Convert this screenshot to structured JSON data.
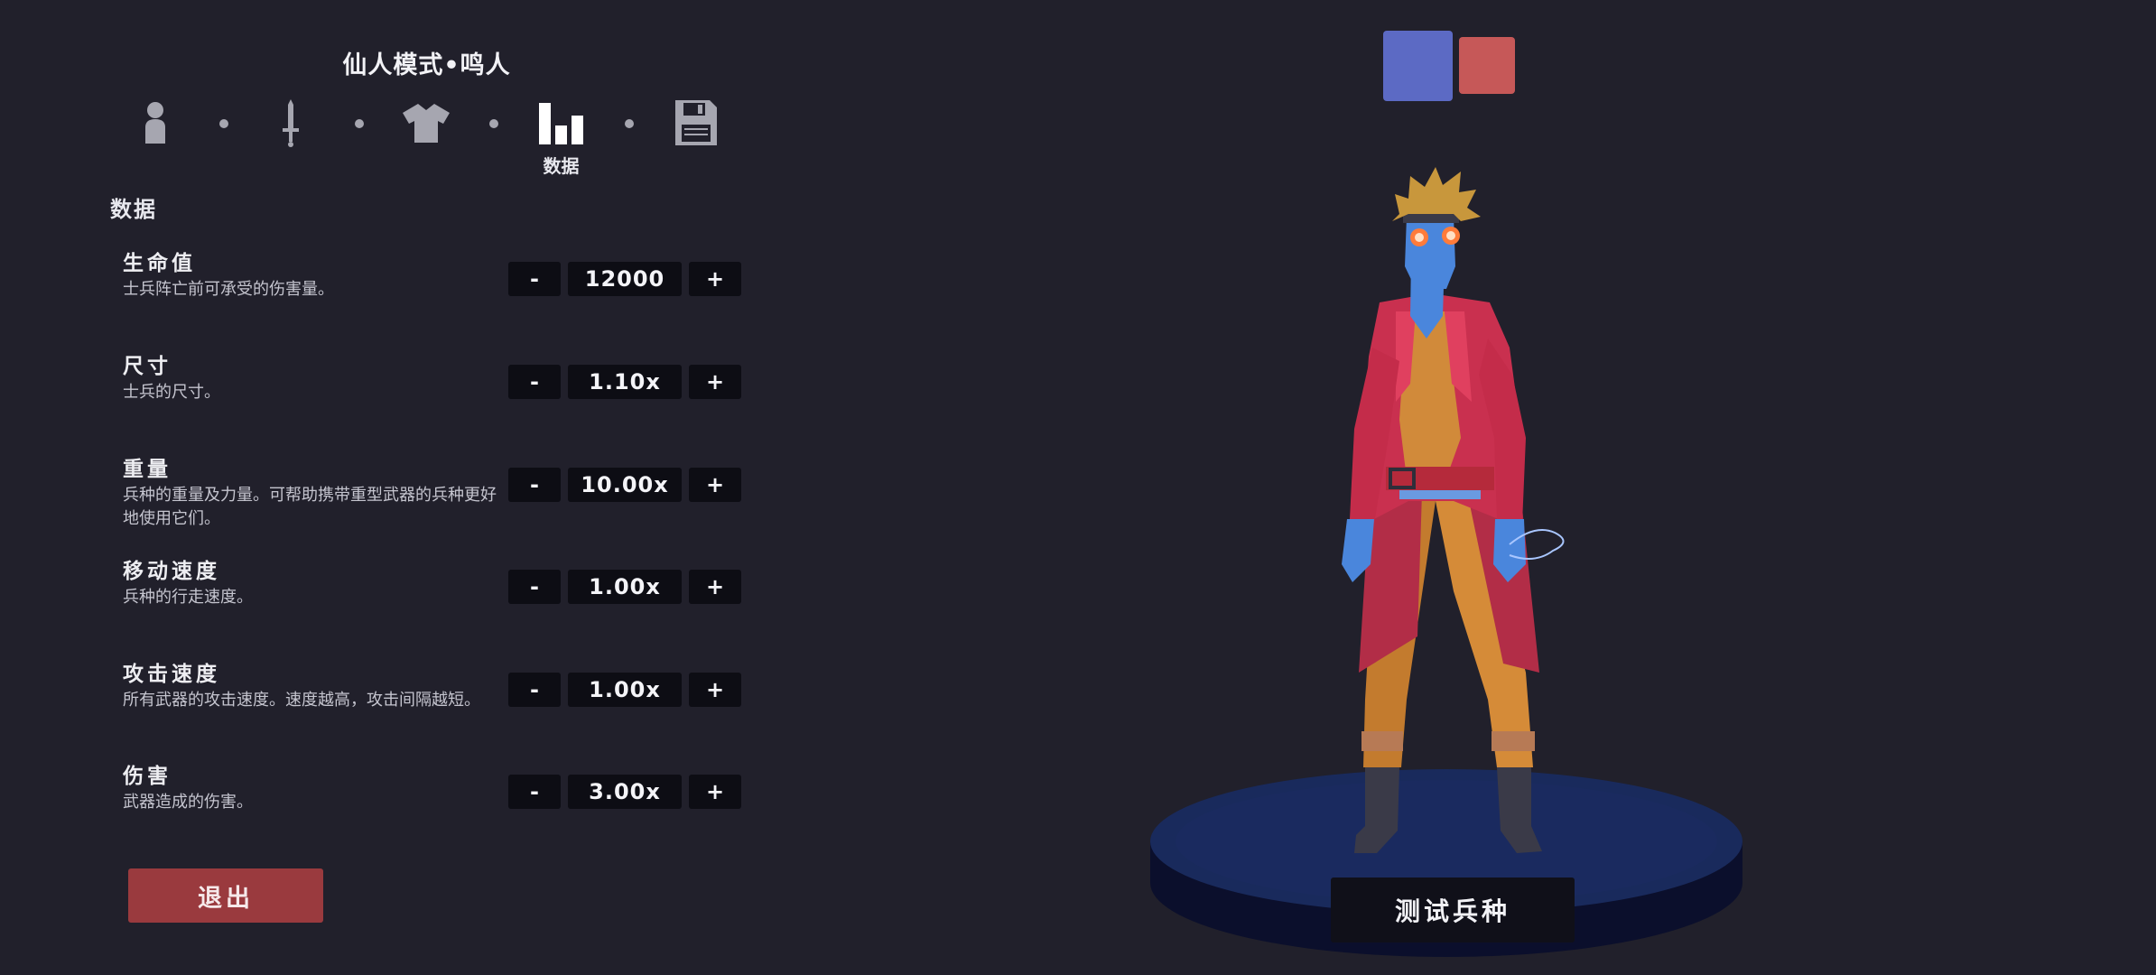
{
  "header": {
    "title": "仙人模式•鸣人",
    "steps": [
      {
        "icon": "person-icon",
        "active": false
      },
      {
        "icon": "sword-icon",
        "active": false
      },
      {
        "icon": "shirt-icon",
        "active": false
      },
      {
        "icon": "bar-chart-icon",
        "active": true,
        "caption": "数据"
      },
      {
        "icon": "floppy-disk-icon",
        "active": false
      }
    ]
  },
  "stats": {
    "section_title": "数据",
    "rows": [
      {
        "name": "生命值",
        "desc": "士兵阵亡前可承受的伤害量。",
        "value": "12000"
      },
      {
        "name": "尺寸",
        "desc": "士兵的尺寸。",
        "value": "1.10x"
      },
      {
        "name": "重量",
        "desc": "兵种的重量及力量。可帮助携带重型武器的兵种更好地使用它们。",
        "value": "10.00x"
      },
      {
        "name": "移动速度",
        "desc": "兵种的行走速度。",
        "value": "1.00x"
      },
      {
        "name": "攻击速度",
        "desc": "所有武器的攻击速度。速度越高，攻击间隔越短。",
        "value": "1.00x"
      },
      {
        "name": "伤害",
        "desc": "武器造成的伤害。",
        "value": "3.00x"
      }
    ],
    "minus_label": "-",
    "plus_label": "+"
  },
  "footer": {
    "exit_label": "退出"
  },
  "preview": {
    "team_colors": {
      "blue": "#5c6ac4",
      "red": "#c65858"
    },
    "selected_team": "blue",
    "test_label": "测试兵种"
  }
}
